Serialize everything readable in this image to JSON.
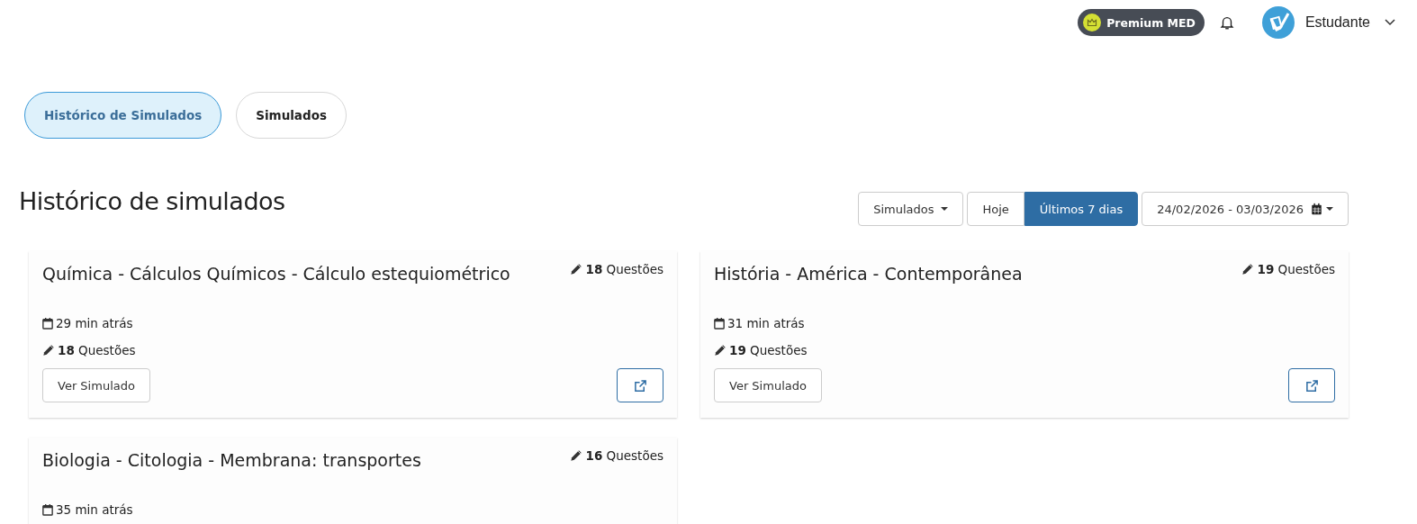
{
  "header": {
    "badge": "Premium MED",
    "user": "Estudante"
  },
  "tabs": [
    {
      "label": "Histórico de Simulados",
      "selected": true
    },
    {
      "label": "Simulados",
      "selected": false
    }
  ],
  "page_title": "Histórico de simulados",
  "filters": {
    "type_dropdown": "Simulados",
    "periods": [
      {
        "label": "Hoje",
        "selected": false
      },
      {
        "label": "Últimos 7 dias",
        "selected": true
      }
    ],
    "date_range": "24/02/2026 - 03/03/2026"
  },
  "cards": [
    {
      "title": "Química - Cálculos Químicos - Cálculo estequiométrico",
      "count": "**18** Questões",
      "time": "29 min atrás",
      "questions": "**18** Questões",
      "button": "Ver Simulado"
    },
    {
      "title": "História - América - Contemporânea",
      "count": "**19** Questões",
      "time": "31 min atrás",
      "questions": "**19** Questões",
      "button": "Ver Simulado"
    },
    {
      "title": "Biologia - Citologia - Membrana: transportes",
      "count": "**16** Questões",
      "time": "35 min atrás"
    }
  ]
}
